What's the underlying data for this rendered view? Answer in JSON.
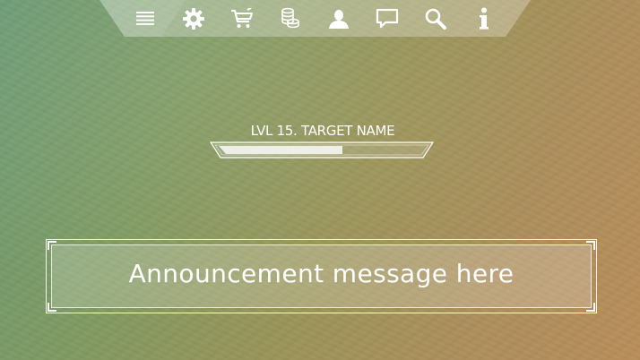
{
  "toolbar": {
    "buttons": [
      {
        "id": "menu",
        "icon": "menu-icon"
      },
      {
        "id": "settings",
        "icon": "gear-icon"
      },
      {
        "id": "shop",
        "icon": "cart-icon"
      },
      {
        "id": "currency",
        "icon": "coins-icon"
      },
      {
        "id": "profile",
        "icon": "user-icon"
      },
      {
        "id": "chat",
        "icon": "chat-bubble-icon"
      },
      {
        "id": "search",
        "icon": "search-icon"
      },
      {
        "id": "info",
        "icon": "info-icon"
      }
    ],
    "icon_color": "#ffffff"
  },
  "target": {
    "label": "LVL 15. TARGET NAME",
    "health_fraction": 0.6
  },
  "announcement": {
    "text": "Announcement message here"
  },
  "colors": {
    "bg_green": "#6b9a74",
    "bg_orange": "#b88d5a",
    "ui_white": "#ffffff"
  }
}
